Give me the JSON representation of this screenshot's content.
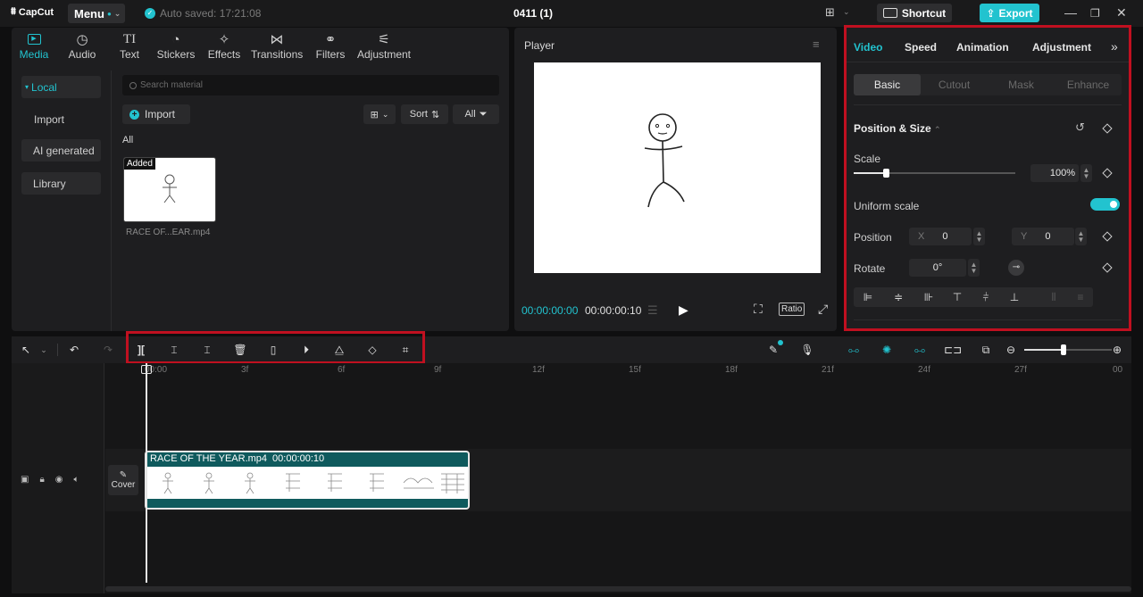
{
  "app": {
    "logo": "CapCut",
    "menu_label": "Menu",
    "autosave": "Auto saved: 17:21:08",
    "project_title": "0411 (1)",
    "shortcut_label": "Shortcut",
    "export_label": "Export"
  },
  "tool_tabs": [
    {
      "label": "Media",
      "icon": "media-icon"
    },
    {
      "label": "Audio",
      "icon": "audio-icon"
    },
    {
      "label": "Text",
      "icon": "text-icon"
    },
    {
      "label": "Stickers",
      "icon": "stickers-icon"
    },
    {
      "label": "Effects",
      "icon": "effects-icon"
    },
    {
      "label": "Transitions",
      "icon": "transitions-icon"
    },
    {
      "label": "Filters",
      "icon": "filters-icon"
    },
    {
      "label": "Adjustment",
      "icon": "adjustment-icon"
    }
  ],
  "media": {
    "sidebar": [
      "Local",
      "Import",
      "AI generated",
      "Library"
    ],
    "search_placeholder": "Search material",
    "import_label": "Import",
    "sort_label": "Sort",
    "filter_label": "All",
    "section_label": "All",
    "item": {
      "badge": "Added",
      "name": "RACE OF...EAR.mp4"
    }
  },
  "player": {
    "title": "Player",
    "current_time": "00:00:00:00",
    "total_time": "00:00:00:10",
    "ratio_label": "Ratio"
  },
  "props": {
    "tabs": [
      "Video",
      "Speed",
      "Animation",
      "Adjustment"
    ],
    "subtabs": [
      "Basic",
      "Cutout",
      "Mask",
      "Enhance"
    ],
    "section": "Position & Size",
    "scale_label": "Scale",
    "scale_value": "100%",
    "scale_fraction": 0.2,
    "uniform_label": "Uniform scale",
    "position_label": "Position",
    "pos_x_label": "X",
    "pos_x": "0",
    "pos_y_label": "Y",
    "pos_y": "0",
    "rotate_label": "Rotate",
    "rotate_value": "0°"
  },
  "timeline": {
    "ruler": [
      "00:00",
      "3f",
      "6f",
      "9f",
      "12f",
      "15f",
      "18f",
      "21f",
      "24f",
      "27f",
      "00"
    ],
    "clip_name": "RACE OF THE YEAR.mp4",
    "clip_duration": "00:00:00:10",
    "cover_label": "Cover",
    "zoom_fraction": 0.45
  },
  "colors": {
    "accent": "#22c3cf",
    "highlight": "#c01020"
  }
}
